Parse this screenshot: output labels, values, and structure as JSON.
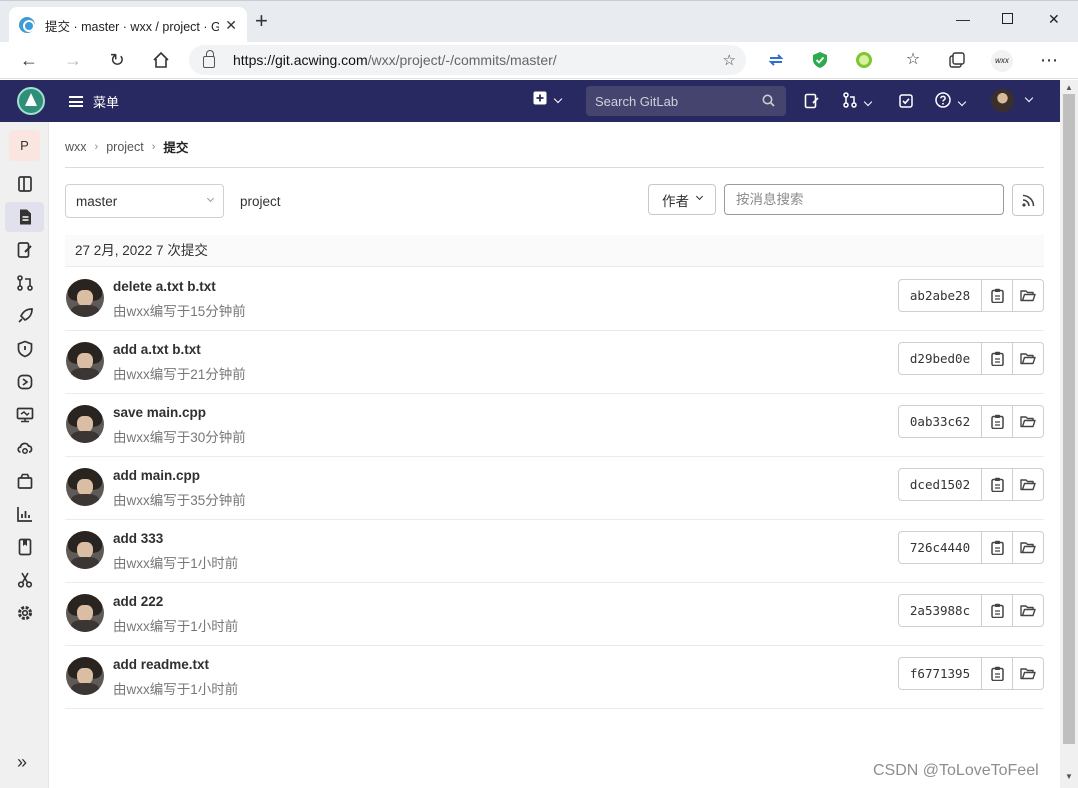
{
  "browser": {
    "tab_title": "提交 · master · wxx / project · GitLab",
    "url_domain": "https://git.acwing.com",
    "url_path": "/wxx/project/-/commits/master/",
    "ext_badge": "wxx"
  },
  "topnav": {
    "menu_label": "菜单",
    "search_placeholder": "Search GitLab"
  },
  "sidebar": {
    "project_letter": "P",
    "icons": [
      "repository-icon",
      "commits-icon",
      "issues-icon",
      "merge-requests-icon",
      "ci-cd-icon",
      "security-icon",
      "deployments-icon",
      "monitor-icon",
      "infrastructure-icon",
      "packages-icon",
      "analytics-icon",
      "wiki-icon",
      "snippets-icon",
      "settings-icon"
    ],
    "active_index": 1
  },
  "breadcrumb": {
    "owner": "wxx",
    "project": "project",
    "current": "提交"
  },
  "filters": {
    "branch": "master",
    "project_name": "project",
    "author_label": "作者",
    "search_placeholder": "按消息搜索"
  },
  "day_header": "27 2月, 2022 7 次提交",
  "commits": [
    {
      "title": "delete a.txt b.txt",
      "meta": "由wxx编写于15分钟前",
      "sha": "ab2abe28"
    },
    {
      "title": "add a.txt b.txt",
      "meta": "由wxx编写于21分钟前",
      "sha": "d29bed0e"
    },
    {
      "title": "save main.cpp",
      "meta": "由wxx编写于30分钟前",
      "sha": "0ab33c62"
    },
    {
      "title": "add main.cpp",
      "meta": "由wxx编写于35分钟前",
      "sha": "dced1502"
    },
    {
      "title": "add 333",
      "meta": "由wxx编写于1小时前",
      "sha": "726c4440"
    },
    {
      "title": "add 222",
      "meta": "由wxx编写于1小时前",
      "sha": "2a53988c"
    },
    {
      "title": "add readme.txt",
      "meta": "由wxx编写于1小时前",
      "sha": "f6771395"
    }
  ],
  "watermark": "CSDN @ToLoveToFeel",
  "colors": {
    "nav_bg": "#292961",
    "search_bg": "#44446f",
    "sidebar_bg": "#f0f0f0",
    "sidebar_active": "#e1e1ee",
    "project_badge": "#fbe5e1"
  }
}
